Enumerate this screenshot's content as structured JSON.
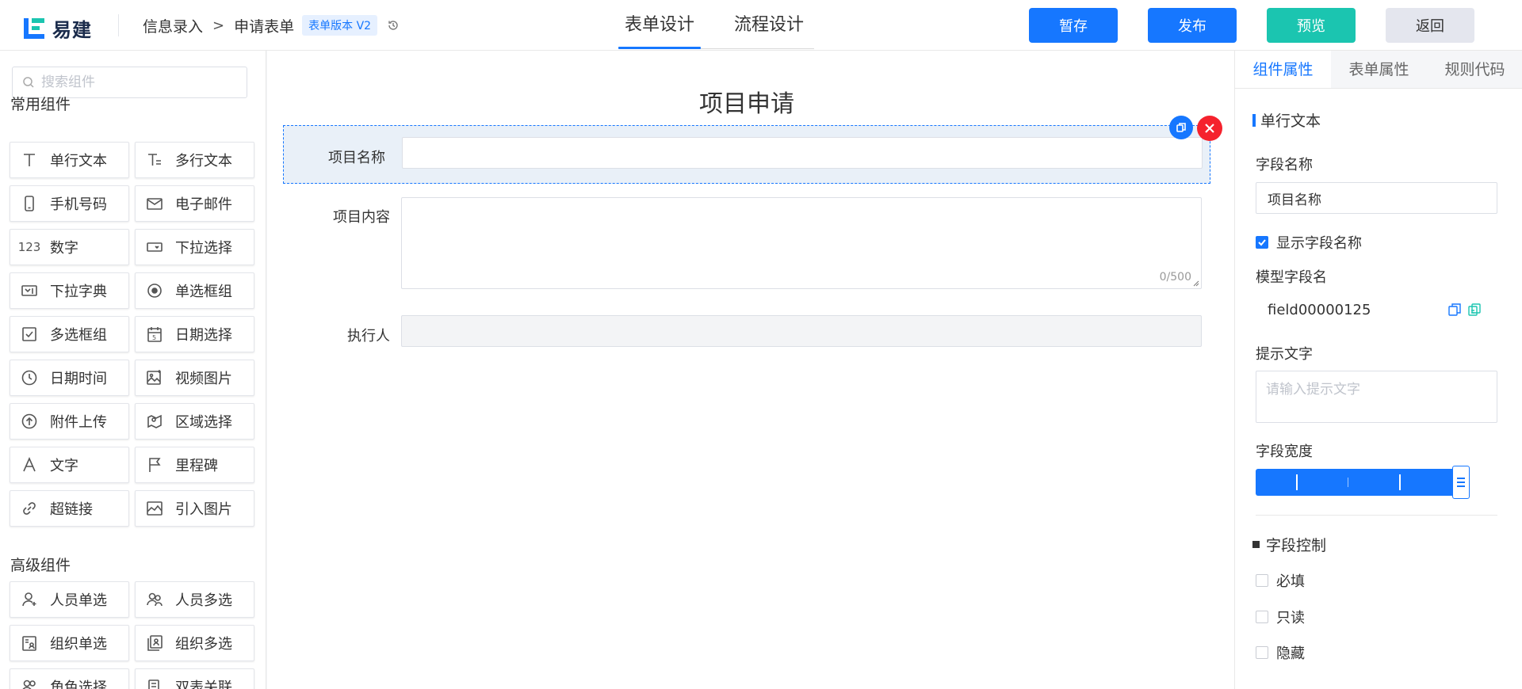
{
  "app": {
    "name": "易建"
  },
  "breadcrumb": {
    "section": "信息录入",
    "page": "申请表单",
    "version": "表单版本 V2"
  },
  "tabs": [
    {
      "label": "表单设计",
      "active": true
    },
    {
      "label": "流程设计",
      "active": false
    }
  ],
  "toolbar": {
    "save": "暂存",
    "publish": "发布",
    "preview": "预览",
    "back": "返回"
  },
  "sidebar": {
    "search_placeholder": "搜索组件",
    "common_title": "常用组件",
    "common": [
      {
        "label": "单行文本",
        "icon": "text-icon"
      },
      {
        "label": "多行文本",
        "icon": "multiline-text-icon"
      },
      {
        "label": "手机号码",
        "icon": "phone-icon"
      },
      {
        "label": "电子邮件",
        "icon": "mail-icon"
      },
      {
        "label": "数字",
        "icon": "number-icon"
      },
      {
        "label": "下拉选择",
        "icon": "select-icon"
      },
      {
        "label": "下拉字典",
        "icon": "dict-select-icon"
      },
      {
        "label": "单选框组",
        "icon": "radio-icon"
      },
      {
        "label": "多选框组",
        "icon": "checkbox-icon"
      },
      {
        "label": "日期选择",
        "icon": "date-icon"
      },
      {
        "label": "日期时间",
        "icon": "clock-icon"
      },
      {
        "label": "视频图片",
        "icon": "image-upload-icon"
      },
      {
        "label": "附件上传",
        "icon": "upload-icon"
      },
      {
        "label": "区域选择",
        "icon": "map-icon"
      },
      {
        "label": "文字",
        "icon": "font-icon"
      },
      {
        "label": "里程碑",
        "icon": "flag-icon"
      },
      {
        "label": "超链接",
        "icon": "link-icon"
      },
      {
        "label": "引入图片",
        "icon": "picture-icon"
      }
    ],
    "advanced_title": "高级组件",
    "advanced": [
      {
        "label": "人员单选",
        "icon": "user-icon"
      },
      {
        "label": "人员多选",
        "icon": "users-icon"
      },
      {
        "label": "组织单选",
        "icon": "org-icon"
      },
      {
        "label": "组织多选",
        "icon": "orgs-icon"
      },
      {
        "label": "角色选择",
        "icon": "role-icon"
      },
      {
        "label": "双表关联",
        "icon": "relation-icon"
      }
    ]
  },
  "form": {
    "title": "项目申请",
    "fields": [
      {
        "label": "项目名称"
      },
      {
        "label": "项目内容",
        "counter": "0/500"
      },
      {
        "label": "执行人"
      }
    ]
  },
  "panel": {
    "tabs": [
      {
        "label": "组件属性",
        "active": true
      },
      {
        "label": "表单属性",
        "active": false
      },
      {
        "label": "规则代码",
        "active": false
      }
    ],
    "component_type": "单行文本",
    "field_name_label": "字段名称",
    "field_name_value": "项目名称",
    "show_name_label": "显示字段名称",
    "show_name_checked": true,
    "model_label": "模型字段名",
    "model_value": "field00000125",
    "hint_label": "提示文字",
    "hint_placeholder": "请输入提示文字",
    "width_label": "字段宽度",
    "width_value": 1.0,
    "control_title": "字段控制",
    "controls": [
      {
        "label": "必填",
        "checked": false
      },
      {
        "label": "只读",
        "checked": false
      },
      {
        "label": "隐藏",
        "checked": false
      }
    ]
  },
  "colors": {
    "primary": "#1677ff",
    "preview": "#1bc5b0",
    "danger": "#f5222d"
  }
}
